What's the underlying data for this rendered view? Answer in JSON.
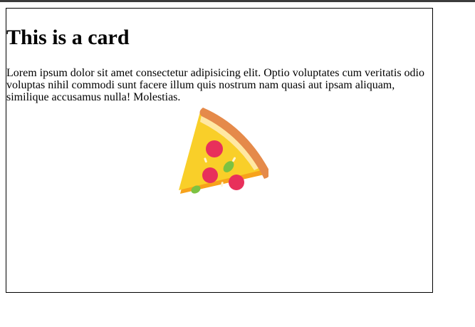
{
  "card": {
    "title": "This is a card",
    "text": "Lorem ipsum dolor sit amet consectetur adipisicing elit. Optio voluptates cum veritatis odio voluptas nihil commodi sunt facere illum quis nostrum nam quasi aut ipsam aliquam, similique accusamus nulla! Molestias.",
    "image_icon": "pizza-slice-icon"
  },
  "colors": {
    "page_background": "#ffffff",
    "card_border": "#000000",
    "crust": "#E58A4A",
    "cheese": "#F9CF29",
    "cheese_edge": "#FFE8A3",
    "pepperoni": "#E8305B",
    "basil": "#7CC242",
    "base": "#F7A21B"
  }
}
